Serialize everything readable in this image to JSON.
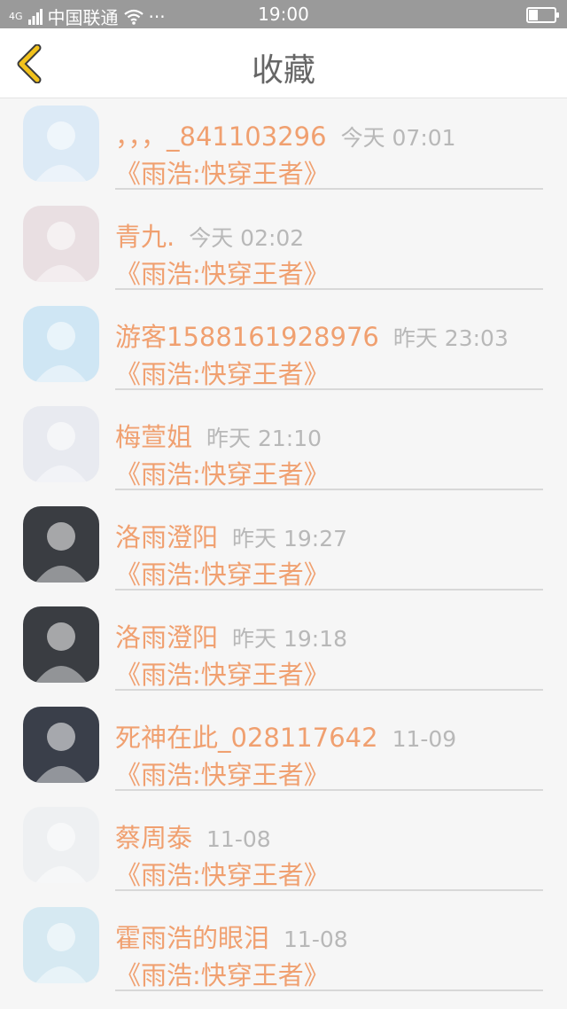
{
  "status_bar": {
    "carrier": "中国联通",
    "network": "4G",
    "more": "···",
    "time": "19:00",
    "battery_level": 0.35
  },
  "header": {
    "title": "收藏",
    "back_icon": "chevron-left-icon"
  },
  "colors": {
    "accent": "#f0a070",
    "muted": "#b8b8b8",
    "back_icon": "#f2c21b"
  },
  "items": [
    {
      "name": "，，，_841103296",
      "time": "今天 07:01",
      "book": "《雨浩:快穿王者》",
      "avatar_bg": "#dceaf6"
    },
    {
      "name": "青九.",
      "time": "今天 02:02",
      "book": "《雨浩:快穿王者》",
      "avatar_bg": "#e9dfe2"
    },
    {
      "name": "游客1588161928976",
      "time": "昨天 23:03",
      "book": "《雨浩:快穿王者》",
      "avatar_bg": "#cfe6f4"
    },
    {
      "name": "梅萱姐",
      "time": "昨天 21:10",
      "book": "《雨浩:快穿王者》",
      "avatar_bg": "#e8eaf0"
    },
    {
      "name": "洛雨澄阳",
      "time": "昨天 19:27",
      "book": "《雨浩:快穿王者》",
      "avatar_bg": "#3a3d42"
    },
    {
      "name": "洛雨澄阳",
      "time": "昨天 19:18",
      "book": "《雨浩:快穿王者》",
      "avatar_bg": "#3a3d42"
    },
    {
      "name": "死神在此_028117642",
      "time": "11-09",
      "book": "《雨浩:快穿王者》",
      "avatar_bg": "#3a3f4a"
    },
    {
      "name": "蔡周泰",
      "time": "11-08",
      "book": "《雨浩:快穿王者》",
      "avatar_bg": "#eef0f2"
    },
    {
      "name": "霍雨浩的眼泪",
      "time": "11-08",
      "book": "《雨浩:快穿王者》",
      "avatar_bg": "#d6e9f2"
    }
  ]
}
